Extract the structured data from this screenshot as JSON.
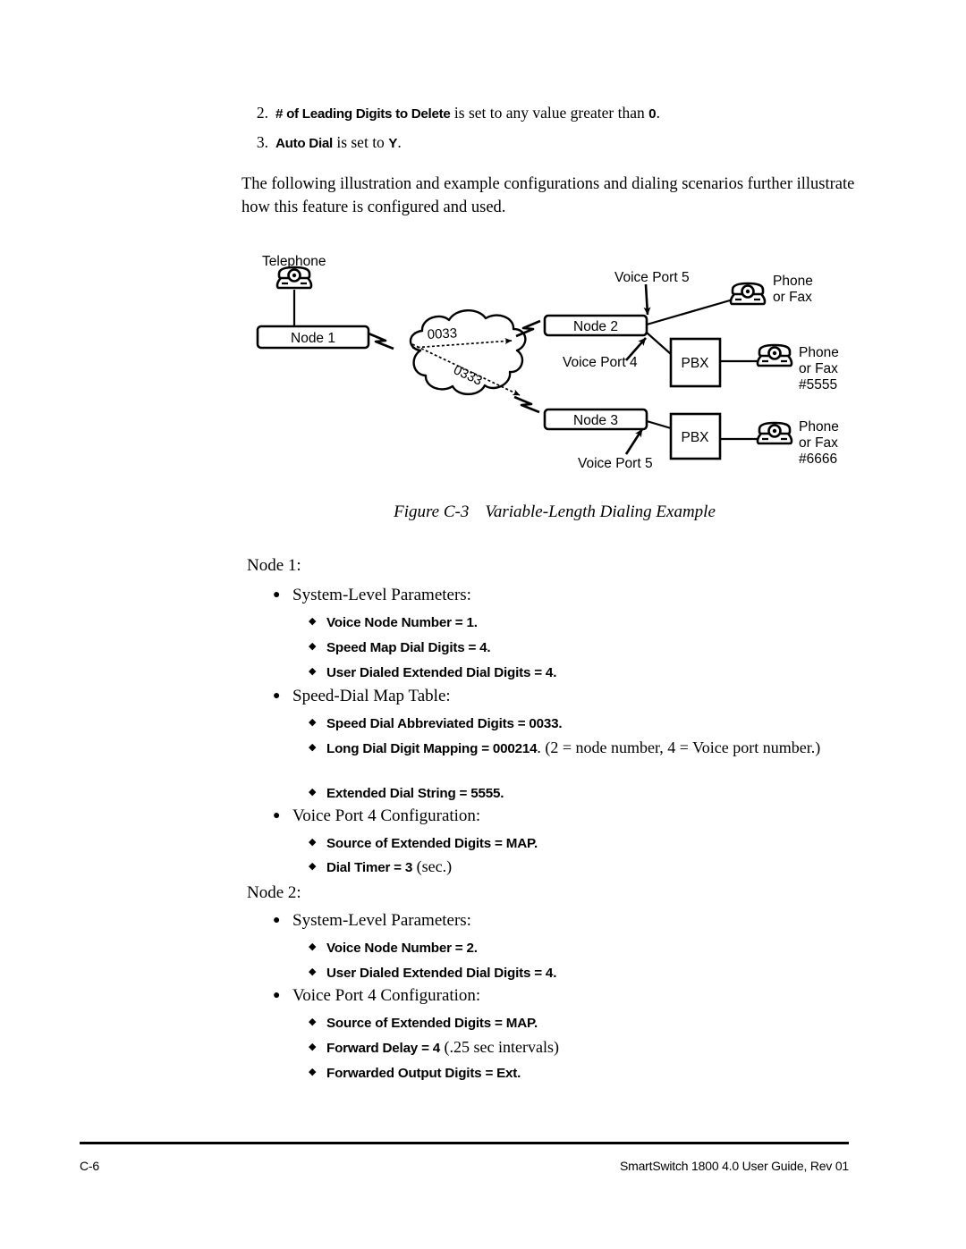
{
  "numbered_items": [
    {
      "num": "2.",
      "bold_term": "# of Leading Digits to Delete",
      "mid_text": " is set to any value greater than ",
      "bold_value": "0",
      "tail": "."
    },
    {
      "num": "3.",
      "bold_term": "Auto Dial",
      "mid_text": " is set to ",
      "bold_value": "Y",
      "tail": "."
    }
  ],
  "intro_paragraph": "The following illustration and example configurations and dialing scenarios further illustrate how this feature is configured and used.",
  "figure": {
    "caption_number": "Figure C-3",
    "caption_title": "Variable-Length Dialing Example",
    "telephone_label": "Telephone",
    "node1_label": "Node 1",
    "node2_label": "Node 2",
    "node3_label": "Node 3",
    "pbx_top_label": "PBX",
    "pbx_bottom_label": "PBX",
    "cloud_route_short": "0033",
    "cloud_route_long": "0333",
    "voice_port_5_top": "Voice Port 5",
    "voice_port_4": "Voice Port 4",
    "voice_port_5_bottom": "Voice Port 5",
    "phone_top_line1": "Phone",
    "phone_top_line2": "or Fax",
    "phone_mid_line1": "Phone",
    "phone_mid_line2": "or Fax",
    "phone_mid_line3": "#5555",
    "phone_bottom_line1": "Phone",
    "phone_bottom_line2": "or Fax",
    "phone_bottom_line3": "#6666"
  },
  "node1": {
    "heading": "Node 1:",
    "groups": [
      {
        "title": "System-Level Parameters:",
        "items": [
          {
            "bold": "Voice Node Number = 1",
            "regular": "",
            "tail": "."
          },
          {
            "bold": "Speed Map Dial Digits = 4",
            "regular": "",
            "tail": "."
          },
          {
            "bold": "User Dialed Extended Dial Digits = 4",
            "regular": "",
            "tail": "."
          }
        ]
      },
      {
        "title": "Speed-Dial Map Table:",
        "items": [
          {
            "bold": "Speed Dial Abbreviated Digits = 0033",
            "regular": "",
            "tail": "."
          },
          {
            "bold": "Long Dial Digit Mapping = 000214",
            "regular": ". (2 = node number, 4 = Voice port number.)",
            "tail": ""
          },
          {
            "bold": "Extended Dial String = 5555",
            "regular": "",
            "tail": "."
          }
        ]
      },
      {
        "title": "Voice Port 4 Configuration:",
        "items": [
          {
            "bold": "Source of Extended Digits = MAP",
            "regular": "",
            "tail": "."
          },
          {
            "bold": "Dial Timer = 3",
            "regular": " (sec.)",
            "tail": ""
          }
        ]
      }
    ]
  },
  "node2": {
    "heading": "Node 2:",
    "groups": [
      {
        "title": "System-Level Parameters:",
        "items": [
          {
            "bold": "Voice Node Number = 2",
            "regular": "",
            "tail": "."
          },
          {
            "bold": "User Dialed Extended Dial Digits = 4",
            "regular": "",
            "tail": "."
          }
        ]
      },
      {
        "title": "Voice Port 4 Configuration:",
        "items": [
          {
            "bold": "Source of Extended Digits = MAP",
            "regular": "",
            "tail": "."
          },
          {
            "bold": "Forward Delay = 4",
            "regular": " (.25 sec intervals)",
            "tail": ""
          },
          {
            "bold": "Forwarded Output Digits = Ext",
            "regular": "",
            "tail": "."
          }
        ]
      }
    ]
  },
  "footer": {
    "page_number": "C-6",
    "document_title": "SmartSwitch 1800 4.0 User Guide, Rev 01"
  }
}
